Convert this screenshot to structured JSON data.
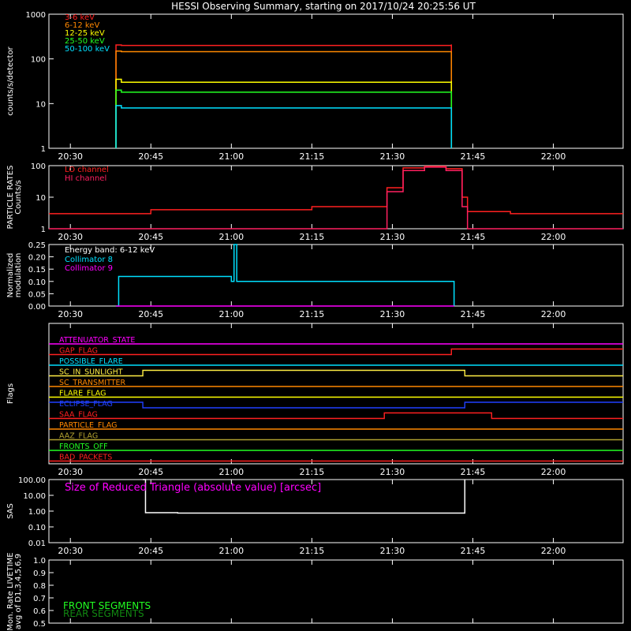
{
  "title": "HESSI Observing Summary, starting on 2017/10/24 20:25:56 UT",
  "time_axis": {
    "ticks": [
      "20:30",
      "20:45",
      "21:00",
      "21:15",
      "21:30",
      "21:45",
      "22:00"
    ],
    "minutes": [
      30,
      45,
      60,
      75,
      90,
      105,
      120
    ],
    "range_minutes": [
      26,
      133
    ]
  },
  "chart_data": [
    {
      "type": "line",
      "name": "panel-count-rates",
      "ylabel": "counts/s/detector",
      "ylim": [
        1,
        1000
      ],
      "yscale": "log",
      "yticks": [
        "1",
        "10",
        "100",
        "1000"
      ],
      "legend_placement": "top-left",
      "x_minutes": [
        38.5,
        38.5,
        39.5,
        101,
        101
      ],
      "series": [
        {
          "name": "3-6 keV",
          "color": "#ff2020",
          "values": [
            1,
            205,
            200,
            210,
            1
          ]
        },
        {
          "name": "6-12 keV",
          "color": "#ff8800",
          "values": [
            1,
            150,
            145,
            150,
            1
          ]
        },
        {
          "name": "12-25 keV",
          "color": "#ffff00",
          "values": [
            1,
            35,
            30,
            32,
            1
          ]
        },
        {
          "name": "25-50 keV",
          "color": "#22ff22",
          "values": [
            1,
            20,
            18,
            19,
            1
          ]
        },
        {
          "name": "50-100 keV",
          "color": "#00e0ff",
          "values": [
            1,
            9,
            8,
            8,
            1
          ]
        }
      ]
    },
    {
      "type": "line",
      "name": "panel-particle-rates",
      "ylabel": "PARTICLE RATES Counts/s",
      "ylim": [
        1,
        100
      ],
      "yscale": "log",
      "yticks": [
        "1",
        "10",
        "100"
      ],
      "legend_placement": "top-left",
      "x_minutes": [
        26,
        45,
        60,
        75,
        87,
        89,
        92,
        96,
        100,
        103,
        104,
        112,
        133
      ],
      "series": [
        {
          "name": "LO channel",
          "color": "#ff2020",
          "values": [
            3,
            4,
            4,
            5,
            5,
            20,
            85,
            95,
            80,
            10,
            3.5,
            3,
            3
          ]
        },
        {
          "name": "HI channel",
          "color": "#ff2060",
          "values": [
            1,
            1,
            1,
            1,
            1,
            15,
            70,
            90,
            70,
            5,
            1,
            1,
            1
          ]
        }
      ]
    },
    {
      "type": "line",
      "name": "panel-modulation",
      "ylabel": "Normalized modulation",
      "ylim": [
        0.0,
        0.25
      ],
      "yticks": [
        "0.00",
        "0.05",
        "0.10",
        "0.15",
        "0.20",
        "0.25"
      ],
      "annotation": "Energy band: 6-12 keV",
      "legend_placement": "top-left",
      "x_minutes": [
        38.5,
        39,
        60,
        60.5,
        61,
        101,
        101.5
      ],
      "series": [
        {
          "name": "Collimator 8",
          "color": "#00e0ff",
          "values": [
            0.0,
            0.12,
            0.1,
            0.25,
            0.1,
            0.1,
            0.0
          ]
        },
        {
          "name": "Collimator 9",
          "color": "#ff00ff",
          "values": [
            0.0,
            0.0,
            0.0,
            0.0,
            0.0,
            0.0,
            0.0
          ]
        }
      ]
    },
    {
      "type": "line",
      "name": "panel-flags",
      "ylabel": "Flags",
      "flags": [
        {
          "name": "ATTENUATOR_STATE",
          "color": "#ff00ff",
          "segments": [
            [
              26,
              133,
              0
            ]
          ]
        },
        {
          "name": "GAP_FLAG",
          "color": "#ff2020",
          "segments": [
            [
              26,
              101,
              0
            ],
            [
              101,
              133,
              1
            ]
          ]
        },
        {
          "name": "POSSIBLE_FLARE",
          "color": "#00e0ff",
          "segments": [
            [
              26,
              133,
              0
            ]
          ]
        },
        {
          "name": "SC_IN_SUNLIGHT",
          "color": "#ffee44",
          "segments": [
            [
              26,
              43.5,
              0
            ],
            [
              43.5,
              103.5,
              1
            ],
            [
              103.5,
              133,
              0
            ]
          ]
        },
        {
          "name": "SC_TRANSMITTER",
          "color": "#ff8800",
          "segments": [
            [
              26,
              133,
              0
            ]
          ]
        },
        {
          "name": "FLARE_FLAG",
          "color": "#ffff00",
          "segments": [
            [
              26,
              133,
              0
            ]
          ]
        },
        {
          "name": "ECLIPSE_FLAG",
          "color": "#2040ff",
          "segments": [
            [
              26,
              43.5,
              1
            ],
            [
              43.5,
              103.5,
              0
            ],
            [
              103.5,
              133,
              1
            ]
          ]
        },
        {
          "name": "SAA_FLAG",
          "color": "#ff2020",
          "segments": [
            [
              26,
              88.5,
              0
            ],
            [
              88.5,
              108.5,
              1
            ],
            [
              108.5,
              133,
              0
            ]
          ]
        },
        {
          "name": "PARTICLE_FLAG",
          "color": "#ff8800",
          "segments": [
            [
              26,
              133,
              0
            ]
          ]
        },
        {
          "name": "AAZ_FLAG",
          "color": "#b0a030",
          "segments": [
            [
              26,
              133,
              0
            ]
          ]
        },
        {
          "name": "FRONTS_OFF",
          "color": "#22ff22",
          "segments": [
            [
              26,
              133,
              0
            ]
          ]
        },
        {
          "name": "BAD_PACKETS",
          "color": "#ff2020",
          "segments": [
            [
              26,
              133,
              0
            ]
          ]
        }
      ]
    },
    {
      "type": "line",
      "name": "panel-sas",
      "ylabel": "SAS",
      "ylim": [
        0.01,
        100
      ],
      "yscale": "log",
      "yticks": [
        "0.01",
        "0.10",
        "1.00",
        "10.00",
        "100.00"
      ],
      "annotation": "Size of Reduced Triangle (absolute value) [arcsec]",
      "x_minutes": [
        43.5,
        44,
        50,
        70,
        90,
        103,
        103.5
      ],
      "series": [
        {
          "name": "",
          "color": "#ffffff",
          "values": [
            100,
            0.8,
            0.75,
            0.75,
            0.75,
            0.75,
            100
          ]
        }
      ]
    },
    {
      "type": "line",
      "name": "panel-livetime",
      "ylabel": "Mon. Rate LIVETIME avg of D1,3,4,5,6,9",
      "ylim": [
        0.5,
        1.0
      ],
      "yticks": [
        "0.5",
        "0.6",
        "0.7",
        "0.8",
        "0.9",
        "1.0"
      ],
      "legend": [
        {
          "name": "FRONT SEGMENTS",
          "color": "#22ff22"
        },
        {
          "name": "REAR SEGMENTS",
          "color": "#118811"
        }
      ]
    }
  ]
}
